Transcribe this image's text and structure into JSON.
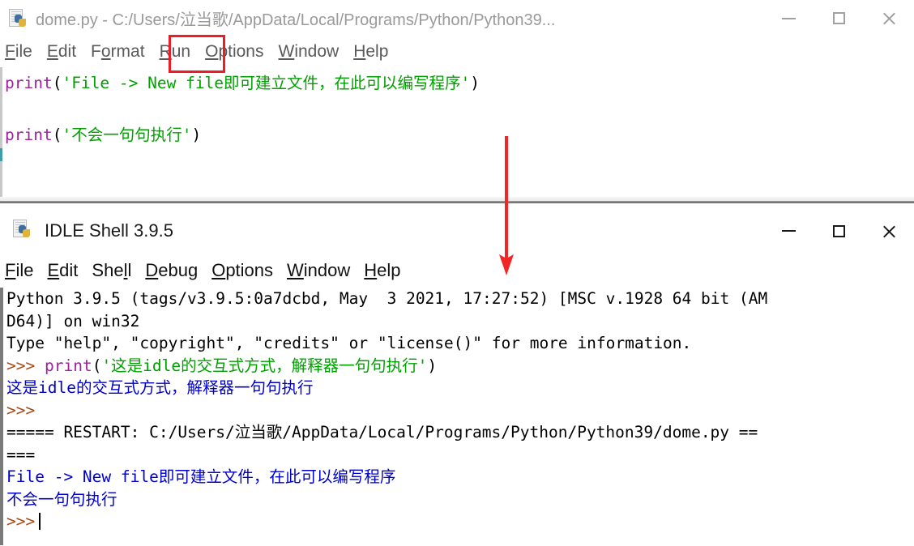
{
  "editor_window": {
    "icon": "python-file-icon",
    "title": "dome.py - C:/Users/泣当歌/AppData/Local/Programs/Python/Python39...",
    "controls": {
      "minimize": "minimize-icon",
      "maximize": "maximize-icon",
      "close": "close-icon"
    },
    "menu": [
      {
        "pre": "",
        "mn": "F",
        "post": "ile"
      },
      {
        "pre": "",
        "mn": "E",
        "post": "dit"
      },
      {
        "pre": "F",
        "mn": "o",
        "post": "rmat"
      },
      {
        "pre": "",
        "mn": "R",
        "post": "un"
      },
      {
        "pre": "",
        "mn": "O",
        "post": "ptions"
      },
      {
        "pre": "",
        "mn": "W",
        "post": "indow"
      },
      {
        "pre": "",
        "mn": "H",
        "post": "elp"
      }
    ],
    "highlight": {
      "target": "Run",
      "color": "#ee1c24"
    },
    "code": {
      "line1_call": "print",
      "line1_open": "(",
      "line1_string": "'File -> New file即可建立文件，在此可以编写程序'",
      "line1_close": ")",
      "line2_call": "print",
      "line2_open": "(",
      "line2_string": "'不会一句句执行'",
      "line2_close": ")"
    }
  },
  "annotation": {
    "arrow": "red-down-arrow",
    "color": "#f22527"
  },
  "shell_window": {
    "icon": "python-file-icon",
    "title": "IDLE Shell 3.9.5",
    "controls": {
      "minimize": "minimize-icon",
      "maximize": "maximize-icon",
      "close": "close-icon"
    },
    "menu": [
      {
        "pre": "",
        "mn": "F",
        "post": "ile"
      },
      {
        "pre": "",
        "mn": "E",
        "post": "dit"
      },
      {
        "pre": "She",
        "mn": "l",
        "post": "l"
      },
      {
        "pre": "",
        "mn": "D",
        "post": "ebug"
      },
      {
        "pre": "",
        "mn": "O",
        "post": "ptions"
      },
      {
        "pre": "",
        "mn": "W",
        "post": "indow"
      },
      {
        "pre": "",
        "mn": "H",
        "post": "elp"
      }
    ],
    "output": {
      "banner1": "Python 3.9.5 (tags/v3.9.5:0a7dcbd, May  3 2021, 17:27:52) [MSC v.1928 64 bit (AM",
      "banner2": "D64)] on win32",
      "banner3": "Type \"help\", \"copyright\", \"credits\" or \"license()\" for more information.",
      "prompt": ">>>",
      "input_call": "print",
      "input_open": "(",
      "input_string": "'这是idle的交互式方式，解释器一句句执行'",
      "input_close": ")",
      "result1": "这是idle的交互式方式，解释器一句句执行",
      "restart_line1": "===== RESTART: C:/Users/泣当歌/AppData/Local/Programs/Python/Python39/dome.py ==",
      "restart_line2": "===",
      "run_out1": "File -> New file即可建立文件，在此可以编写程序",
      "run_out2": "不会一句句执行"
    }
  },
  "colors": {
    "keyword": "#a020a0",
    "string": "#00a000",
    "prompt": "#a84a1a",
    "stdout": "#0000cc",
    "annotation": "#ee1c24"
  }
}
